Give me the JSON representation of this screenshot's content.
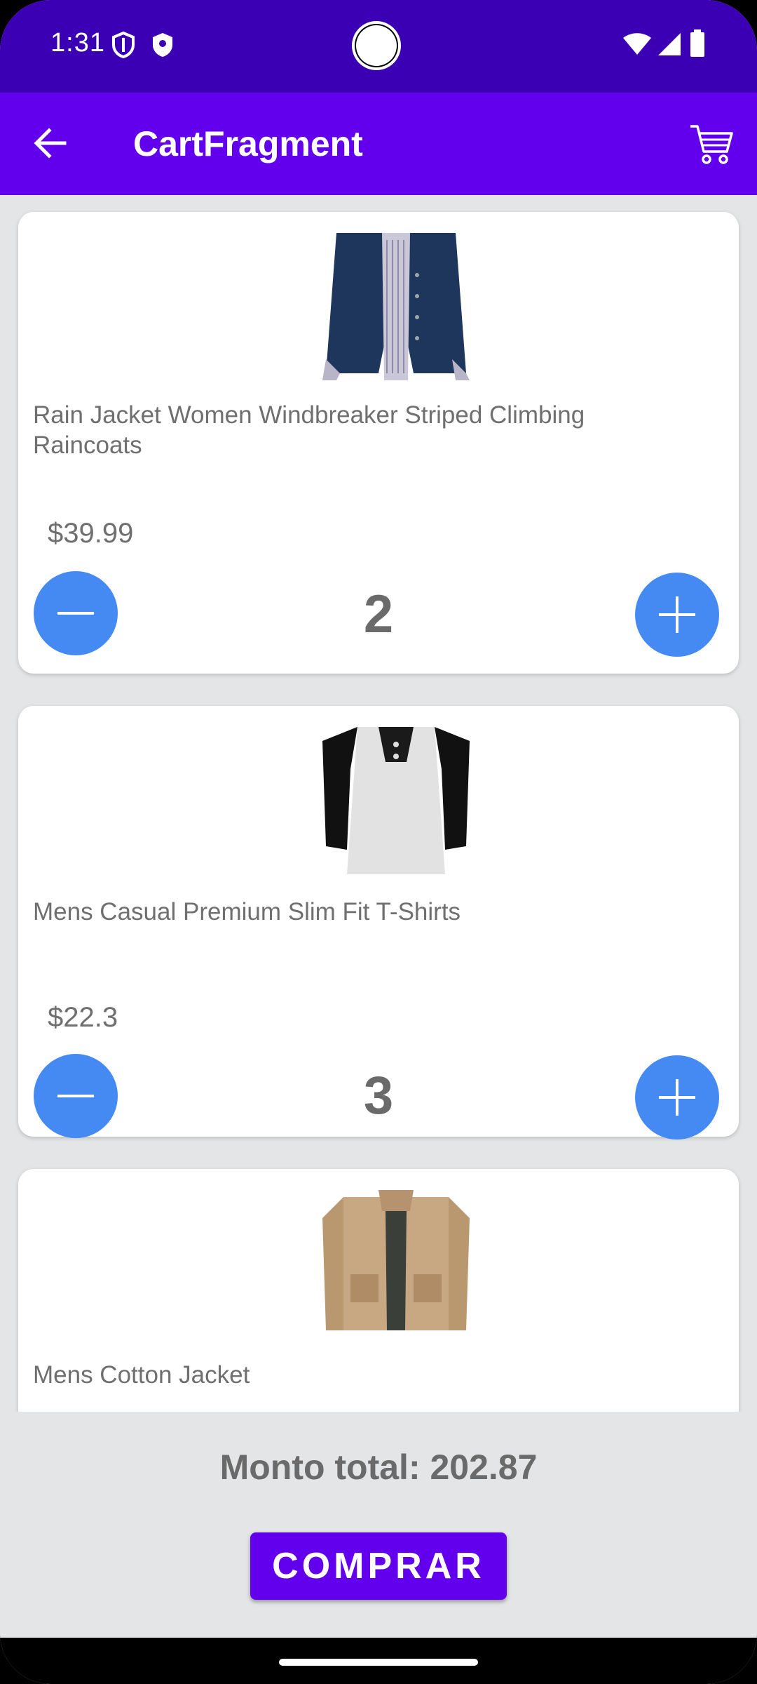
{
  "status_bar": {
    "time": "1:31"
  },
  "app_bar": {
    "title": "CartFragment"
  },
  "cart": {
    "items": [
      {
        "title": "Rain Jacket Women Windbreaker Striped Climbing Raincoats",
        "price": "$39.99",
        "quantity": "2"
      },
      {
        "title": "Mens Casual Premium Slim Fit T-Shirts",
        "price": "$22.3",
        "quantity": "3"
      },
      {
        "title": "Mens Cotton Jacket",
        "price": "",
        "quantity": ""
      }
    ]
  },
  "footer": {
    "total_label": "Monto total: 202.87",
    "buy_label": "COMPRAR"
  },
  "colors": {
    "status_bar": "#3b00b3",
    "app_bar": "#6200ee",
    "qty_button": "#448af2",
    "buy_button": "#6200ee",
    "background": "#e3e5e6"
  }
}
